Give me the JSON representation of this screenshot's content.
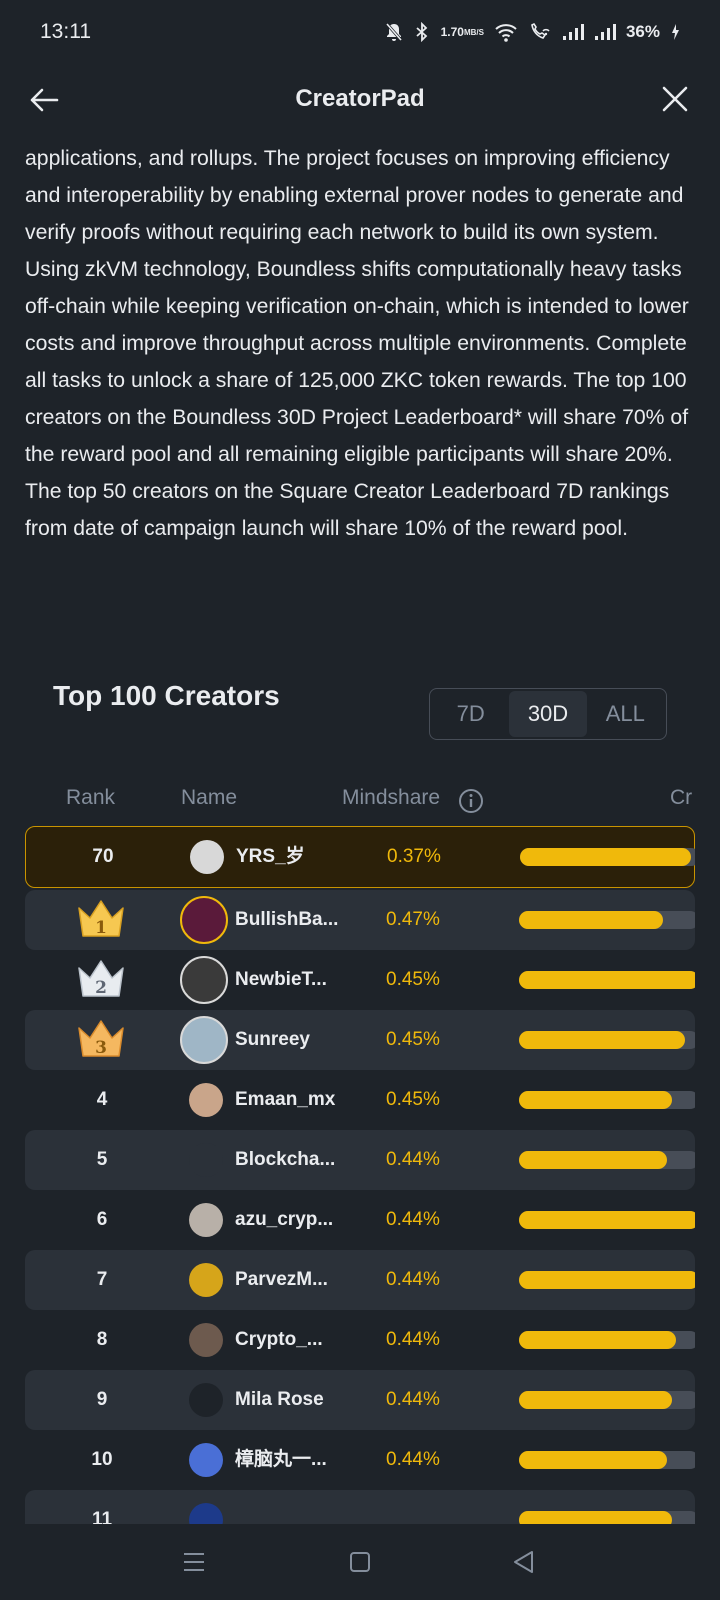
{
  "status": {
    "time": "13:11",
    "net_speed_value": "1.70",
    "net_speed_unit": "MB/S",
    "battery": "36%",
    "icons": [
      "mute-icon",
      "bluetooth-icon",
      "wifi-icon",
      "wifi-calling-icon",
      "signal-icon",
      "signal-icon",
      "battery-charging-icon"
    ]
  },
  "header": {
    "title": "CreatorPad",
    "back_icon": "arrow-left-icon",
    "close_icon": "close-icon"
  },
  "description": "applications, and rollups. The project focuses on improving efficiency and interoperability by enabling external prover nodes to generate and verify proofs without requiring each network to build its own system. Using zkVM technology, Boundless shifts computationally heavy tasks off-chain while keeping verification on-chain, which is intended to lower costs and improve throughput across multiple environments. Complete all tasks to unlock a share of 125,000 ZKC token rewards. The top 100 creators on the Boundless 30D Project Leaderboard* will share 70% of the reward pool and all remaining eligible participants will share 20%. The top 50 creators on the Square Creator Leaderboard 7D rankings from date of campaign launch will share 10% of the reward pool.",
  "leaderboard": {
    "title": "Top 100 Creators",
    "periods": [
      "7D",
      "30D",
      "ALL"
    ],
    "active_period": "30D",
    "columns": {
      "rank": "Rank",
      "name": "Name",
      "mindshare": "Mindshare",
      "cr": "Cr"
    },
    "me": {
      "rank": "70",
      "name": "YRS_岁",
      "mindshare": "0.37%",
      "bar": 0.95,
      "avatar_color": "#d8d8d8"
    },
    "rows": [
      {
        "rank": "1",
        "crown": "gold",
        "name": "BullishBa...",
        "mindshare": "0.47%",
        "bar": 0.8,
        "avatar_color": "#5a1a3a"
      },
      {
        "rank": "2",
        "crown": "silver",
        "name": "NewbieT...",
        "mindshare": "0.45%",
        "bar": 1.0,
        "avatar_color": "#3a3a3a"
      },
      {
        "rank": "3",
        "crown": "bronze",
        "name": "Sunreey",
        "mindshare": "0.45%",
        "bar": 0.92,
        "avatar_color": "#9fb6c6"
      },
      {
        "rank": "4",
        "name": "Emaan_mx",
        "mindshare": "0.45%",
        "bar": 0.85,
        "avatar_color": "#c9a58a"
      },
      {
        "rank": "5",
        "name": "Blockcha...",
        "mindshare": "0.44%",
        "bar": 0.82,
        "avatar_color": "#2b3139"
      },
      {
        "rank": "6",
        "name": "azu_cryp...",
        "mindshare": "0.44%",
        "bar": 1.0,
        "avatar_color": "#b8b0a8"
      },
      {
        "rank": "7",
        "name": "ParvezM...",
        "mindshare": "0.44%",
        "bar": 1.0,
        "avatar_color": "#d6a51a"
      },
      {
        "rank": "8",
        "name": "Crypto_...",
        "mindshare": "0.44%",
        "bar": 0.87,
        "avatar_color": "#6d5a4e"
      },
      {
        "rank": "9",
        "name": "Mila Rose",
        "mindshare": "0.44%",
        "bar": 0.85,
        "avatar_color": "#1e2329"
      },
      {
        "rank": "10",
        "name": "樟脑丸一...",
        "mindshare": "0.44%",
        "bar": 0.82,
        "avatar_color": "#4a6fd6"
      },
      {
        "rank": "11",
        "name": "",
        "mindshare": "",
        "bar": 0.85,
        "avatar_color": "#1d3a8a"
      }
    ]
  },
  "navbar": {
    "icons": [
      "menu-icon",
      "home-square-icon",
      "back-triangle-icon"
    ]
  },
  "colors": {
    "background": "#1e2329",
    "accent": "#f0b90b",
    "row_alt": "#2b3139",
    "highlight_row": "#2b2009"
  }
}
